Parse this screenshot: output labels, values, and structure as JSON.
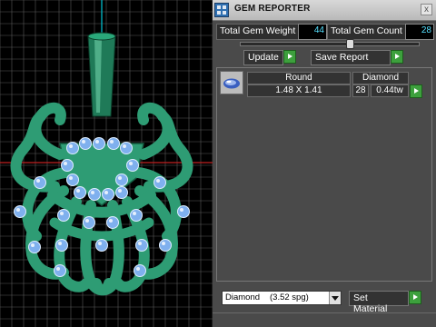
{
  "panel": {
    "title": "GEM REPORTER",
    "close_label": "x",
    "total_weight_label": "Total Gem Weight",
    "total_weight_value": "44",
    "total_count_label": "Total Gem Count",
    "total_count_value": "28",
    "update_label": "Update",
    "save_report_label": "Save Report",
    "gem_list": {
      "headers": [
        "Round",
        "Diamond"
      ],
      "rows": [
        {
          "icon": "gem-oval-icon",
          "size": "1.48 X 1.41",
          "count": "28",
          "weight": "0.44tw"
        }
      ]
    },
    "material_select": {
      "name": "Diamond",
      "spg": "(3.52 spg)"
    },
    "set_material_label": "Set Material"
  },
  "colors": {
    "viewport_bg": "#000000",
    "grid": "#5a5a5a",
    "axis_red": "#c02020",
    "axis_cyan": "#00c8d8",
    "model_green": "#2e9c74",
    "gem_blue": "#7fb0ee",
    "panel_bg": "#4a4a4a",
    "value_cyan": "#55e0ff",
    "go_green": "#3da03d"
  },
  "viewport": {
    "model": "octopus-pendant-model",
    "gem_count_visible": 28
  }
}
